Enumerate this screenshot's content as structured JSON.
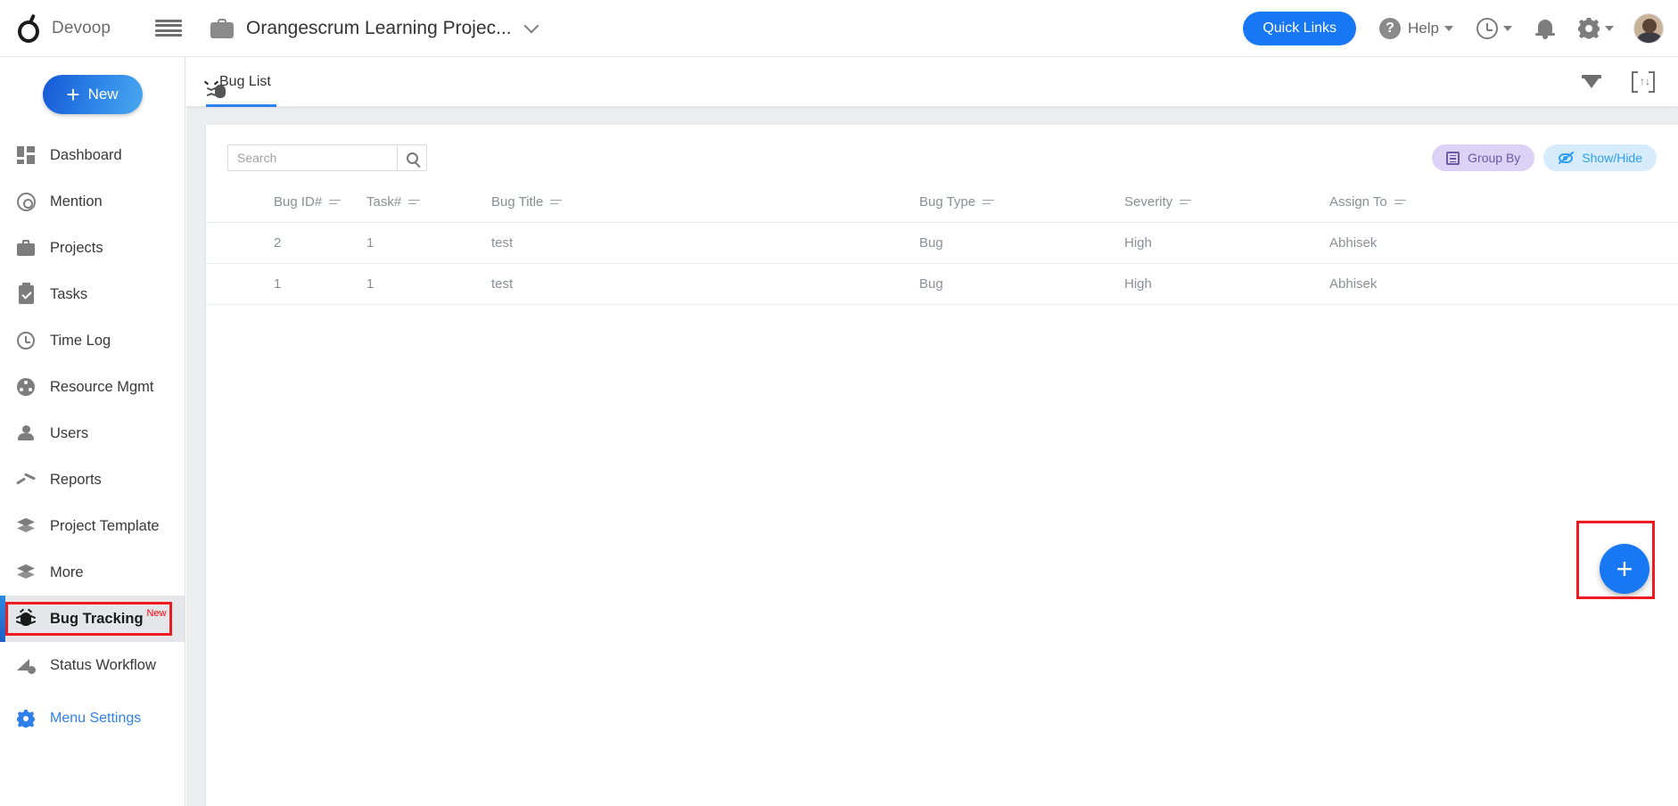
{
  "header": {
    "brand_name": "Devoop",
    "logo_icon": "orange-logo",
    "menu_icon": "hamburger-icon",
    "project_icon": "briefcase-icon",
    "project_title": "Orangescrum Learning Projec...",
    "project_dropdown_icon": "chevron-down-icon",
    "quick_links_label": "Quick Links",
    "help_label": "Help",
    "help_icon": "question-circle-icon",
    "timer_icon": "clock-icon",
    "notification_icon": "bell-icon",
    "settings_icon": "gear-icon",
    "avatar_icon": "user-avatar"
  },
  "sidebar": {
    "new_button_label": "New",
    "new_button_icon": "plus-icon",
    "items": [
      {
        "label": "Dashboard",
        "icon": "dashboard-icon"
      },
      {
        "label": "Mention",
        "icon": "at-icon"
      },
      {
        "label": "Projects",
        "icon": "briefcase-icon"
      },
      {
        "label": "Tasks",
        "icon": "clipboard-check-icon"
      },
      {
        "label": "Time Log",
        "icon": "clock-icon"
      },
      {
        "label": "Resource Mgmt",
        "icon": "resource-icon"
      },
      {
        "label": "Users",
        "icon": "user-icon"
      },
      {
        "label": "Reports",
        "icon": "chart-line-icon"
      },
      {
        "label": "Project Template",
        "icon": "layers-icon"
      },
      {
        "label": "More",
        "icon": "layers-icon"
      },
      {
        "label": "Bug Tracking",
        "icon": "bug-icon",
        "badge": "New",
        "active": true,
        "highlighted": true
      },
      {
        "label": "Status Workflow",
        "icon": "workflow-icon"
      },
      {
        "label": "Menu Settings",
        "icon": "gear-icon-blue",
        "style": "link"
      }
    ]
  },
  "tabbar": {
    "tabs": [
      {
        "label": "Bug List",
        "icon": "bug-icon",
        "active": true
      }
    ],
    "filter_icon": "filter-funnel-icon",
    "import_export_icon": "import-export-icon"
  },
  "toolbar": {
    "search_placeholder": "Search",
    "search_value": "",
    "search_icon": "search-icon",
    "group_by_label": "Group By",
    "group_by_icon": "list-icon",
    "show_hide_label": "Show/Hide",
    "show_hide_icon": "eye-slash-icon"
  },
  "table": {
    "columns": [
      {
        "key": "bug_id",
        "label": "Bug ID#",
        "sort_icon": "sort-icon"
      },
      {
        "key": "task",
        "label": "Task#",
        "sort_icon": "sort-icon"
      },
      {
        "key": "title",
        "label": "Bug Title",
        "sort_icon": "sort-icon"
      },
      {
        "key": "bug_type",
        "label": "Bug Type",
        "sort_icon": "sort-icon"
      },
      {
        "key": "severity",
        "label": "Severity",
        "sort_icon": "sort-icon"
      },
      {
        "key": "assign_to",
        "label": "Assign To",
        "sort_icon": "sort-icon"
      }
    ],
    "rows": [
      {
        "bug_id": "2",
        "task": "1",
        "title": "test",
        "bug_type": "Bug",
        "severity": "High",
        "assign_to": "Abhisek"
      },
      {
        "bug_id": "1",
        "task": "1",
        "title": "test",
        "bug_type": "Bug",
        "severity": "High",
        "assign_to": "Abhisek"
      }
    ]
  },
  "fab": {
    "label": "+",
    "icon": "plus-icon",
    "highlighted": true
  },
  "colors": {
    "accent_blue": "#1877f2",
    "link_blue": "#2f6fe0",
    "bug_red": "#f4511e",
    "badge_red": "#ff0000",
    "highlight_red": "#ee1b23",
    "group_by_purple": "#6a5aa8",
    "show_hide_blue": "#2f9ef0"
  }
}
